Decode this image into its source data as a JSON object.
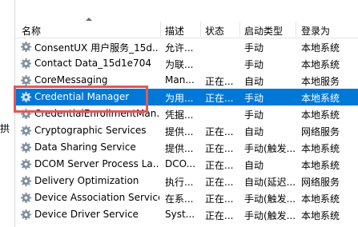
{
  "left_fragment": "拱",
  "columns": {
    "name": "名称",
    "description": "描述",
    "status": "状态",
    "startup_type": "启动类型",
    "logon_as": "登录为"
  },
  "rows": [
    {
      "name": "ConsentUX 用户服务_15d...",
      "description": "允许...",
      "status": "",
      "startup": "手动",
      "logon": "本地系统"
    },
    {
      "name": "Contact Data_15d1e704",
      "description": "为联...",
      "status": "",
      "startup": "手动",
      "logon": "本地系统"
    },
    {
      "name": "CoreMessaging",
      "description": "Man...",
      "status": "正在...",
      "startup": "自动",
      "logon": "本地服务"
    },
    {
      "name": "Credential Manager",
      "description": "为用...",
      "status": "正在...",
      "startup": "手动",
      "logon": "本地系统"
    },
    {
      "name": "CredentialEnrollmentMan...",
      "description": "凭据...",
      "status": "",
      "startup": "手动",
      "logon": "本地系统"
    },
    {
      "name": "Cryptographic Services",
      "description": "提供...",
      "status": "正在...",
      "startup": "自动",
      "logon": "网络服务"
    },
    {
      "name": "Data Sharing Service",
      "description": "提供...",
      "status": "正在...",
      "startup": "手动(触发...",
      "logon": "本地系统"
    },
    {
      "name": "DCOM Server Process La...",
      "description": "DCO...",
      "status": "正在...",
      "startup": "自动",
      "logon": "本地系统"
    },
    {
      "name": "Delivery Optimization",
      "description": "执行...",
      "status": "正在...",
      "startup": "自动(延迟...",
      "logon": "网络服务"
    },
    {
      "name": "Device Association Service",
      "description": "在系...",
      "status": "正在...",
      "startup": "手动(触发...",
      "logon": "本地系统"
    },
    {
      "name": "Device Driver Service",
      "description": "Syst...",
      "status": "正在...",
      "startup": "手动(触发...",
      "logon": "本地系统"
    }
  ],
  "selected_row_index": 3,
  "colors": {
    "selection": "#0078d7",
    "highlight_box": "#e05a5a"
  },
  "icon": "gear-icon"
}
